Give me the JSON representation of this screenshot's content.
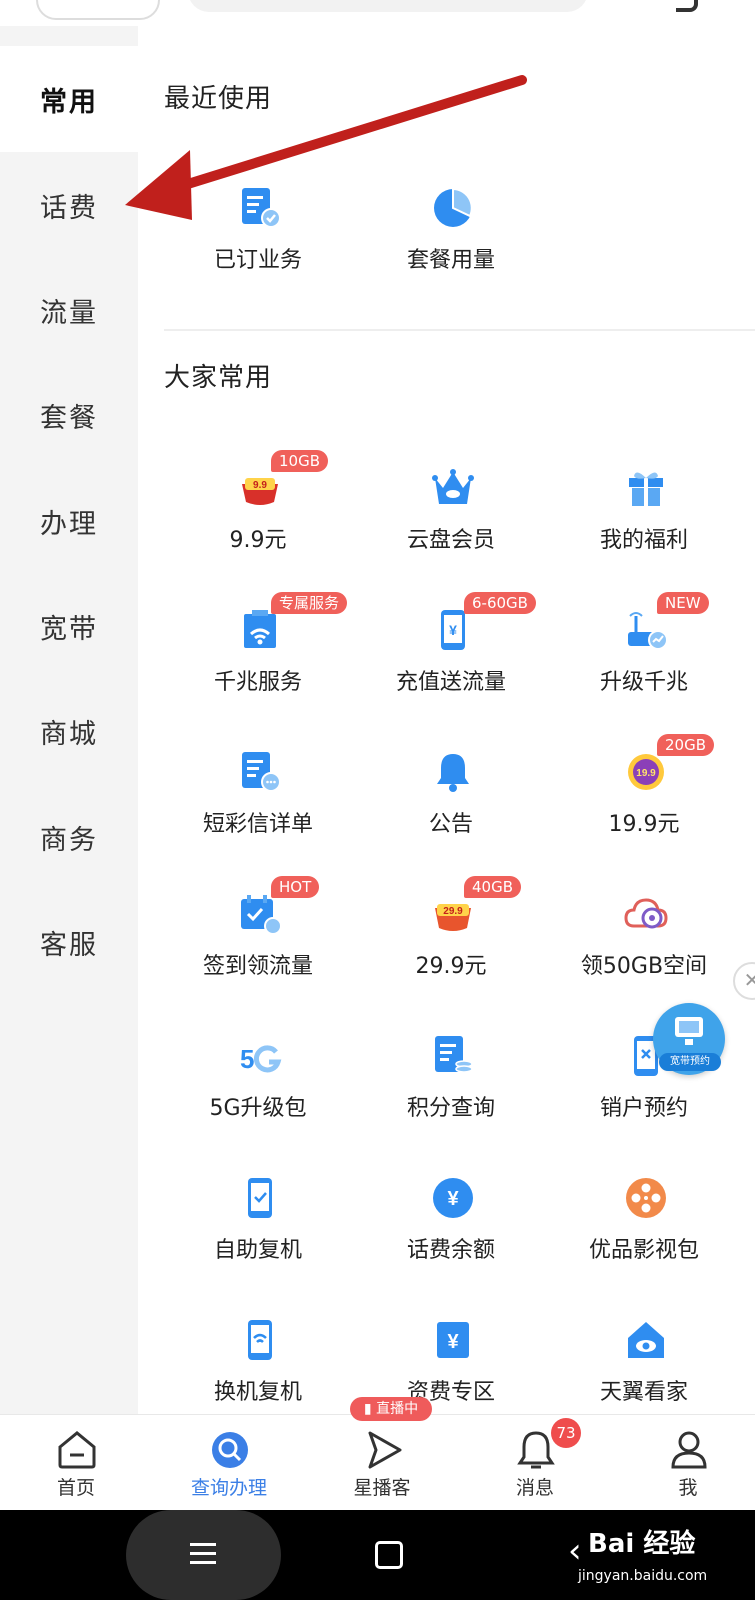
{
  "sidebar": {
    "items": [
      {
        "label": "常用",
        "active": true
      },
      {
        "label": "话费"
      },
      {
        "label": "流量"
      },
      {
        "label": "套餐"
      },
      {
        "label": "办理"
      },
      {
        "label": "宽带"
      },
      {
        "label": "商城"
      },
      {
        "label": "商务"
      },
      {
        "label": "客服"
      }
    ]
  },
  "recent": {
    "title": "最近使用",
    "items": [
      {
        "label": "已订业务",
        "icon": "subscribed-services-icon"
      },
      {
        "label": "套餐用量",
        "icon": "plan-usage-pie-icon"
      }
    ]
  },
  "popular": {
    "title": "大家常用",
    "items": [
      {
        "label": "9.9元",
        "icon": "gift-bowl-icon",
        "badge": "10GB"
      },
      {
        "label": "云盘会员",
        "icon": "crown-cloud-icon"
      },
      {
        "label": "我的福利",
        "icon": "gift-box-icon"
      },
      {
        "label": "千兆服务",
        "icon": "wifi-building-icon",
        "badge": "专属服务"
      },
      {
        "label": "充值送流量",
        "icon": "phone-yuan-icon",
        "badge": "6-60GB"
      },
      {
        "label": "升级千兆",
        "icon": "router-icon",
        "badge": "NEW"
      },
      {
        "label": "短彩信详单",
        "icon": "message-doc-icon"
      },
      {
        "label": "公告",
        "icon": "bell-icon"
      },
      {
        "label": "19.9元",
        "icon": "coin-19-9-icon",
        "badge": "20GB"
      },
      {
        "label": "签到领流量",
        "icon": "calendar-check-icon",
        "badge": "HOT"
      },
      {
        "label": "29.9元",
        "icon": "coin-29-9-icon",
        "badge": "40GB"
      },
      {
        "label": "领50GB空间",
        "icon": "cloud-disk-icon"
      },
      {
        "label": "5G升级包",
        "icon": "5g-icon"
      },
      {
        "label": "积分查询",
        "icon": "points-doc-icon"
      },
      {
        "label": "销户预约",
        "icon": "phone-cancel-icon"
      },
      {
        "label": "自助复机",
        "icon": "phone-check-icon"
      },
      {
        "label": "话费余额",
        "icon": "yuan-circle-icon"
      },
      {
        "label": "优品影视包",
        "icon": "film-reel-icon"
      },
      {
        "label": "换机复机",
        "icon": "phone-wifi-icon"
      },
      {
        "label": "资费专区",
        "icon": "yuan-book-icon"
      },
      {
        "label": "天翼看家",
        "icon": "home-eye-icon"
      }
    ]
  },
  "float_widget": {
    "label": "宽带预约"
  },
  "tabbar": {
    "items": [
      {
        "label": "首页",
        "icon": "home-icon"
      },
      {
        "label": "查询办理",
        "icon": "query-icon",
        "active": true
      },
      {
        "label": "星播客",
        "icon": "play-icon"
      },
      {
        "label": "消息",
        "icon": "bell-icon"
      },
      {
        "label": "我",
        "icon": "user-icon"
      }
    ],
    "live_badge": "直播中",
    "message_count": "73"
  },
  "watermark": {
    "text": "Bai 经验",
    "sub": "jingyan.baidu.com"
  },
  "colors": {
    "accent_blue": "#2f8df0",
    "active_tab": "#3b7fe6",
    "badge_red": "#f0605a",
    "arrow_red": "#c0201c"
  }
}
